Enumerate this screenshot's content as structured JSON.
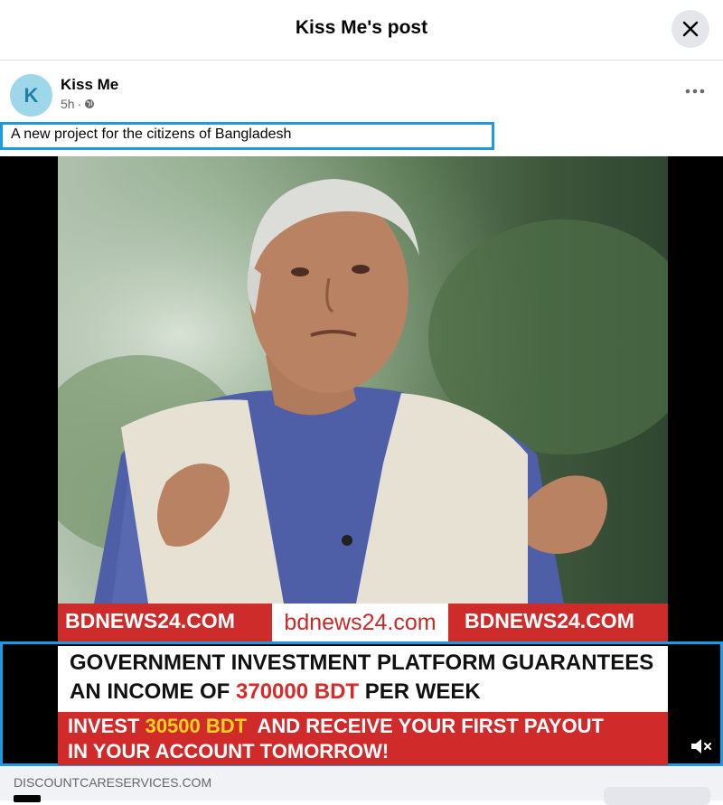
{
  "header": {
    "title": "Kiss Me's post",
    "close_icon": "close-icon"
  },
  "post": {
    "author": {
      "name": "Kiss Me",
      "avatar_initial": "K",
      "avatar_color": "#9fd7ea"
    },
    "time": "5h",
    "audience_icon": "globe-icon",
    "more_icon": "more-dots-icon",
    "text": "A new project for the citizens of Bangladesh"
  },
  "media": {
    "banner": {
      "left": "BDNEWS24.COM",
      "center": "bdnews24.com",
      "right": "BDNEWS24.COM",
      "color": "#ce2b2b"
    },
    "ad": {
      "line1": "GOVERNMENT INVESTMENT PLATFORM GUARANTEES",
      "line2_prefix": "AN INCOME OF ",
      "line2_amount": "370000 BDT",
      "line2_suffix": " PER WEEK",
      "line3_prefix": "INVEST ",
      "line3_amount": "30500 BDT",
      "line3_suffix": "  AND RECEIVE YOUR FIRST PAYOUT",
      "line4": "IN YOUR ACCOUNT TOMORROW!",
      "red_color": "#d12a2a",
      "yellow_color": "#ffd21f"
    },
    "mute_icon": "volume-muted-icon"
  },
  "link_preview": {
    "domain": "DISCOUNTCARESERVICES.COM"
  },
  "colors": {
    "highlight_border": "#1b9be4",
    "muted_text": "#65676b"
  }
}
